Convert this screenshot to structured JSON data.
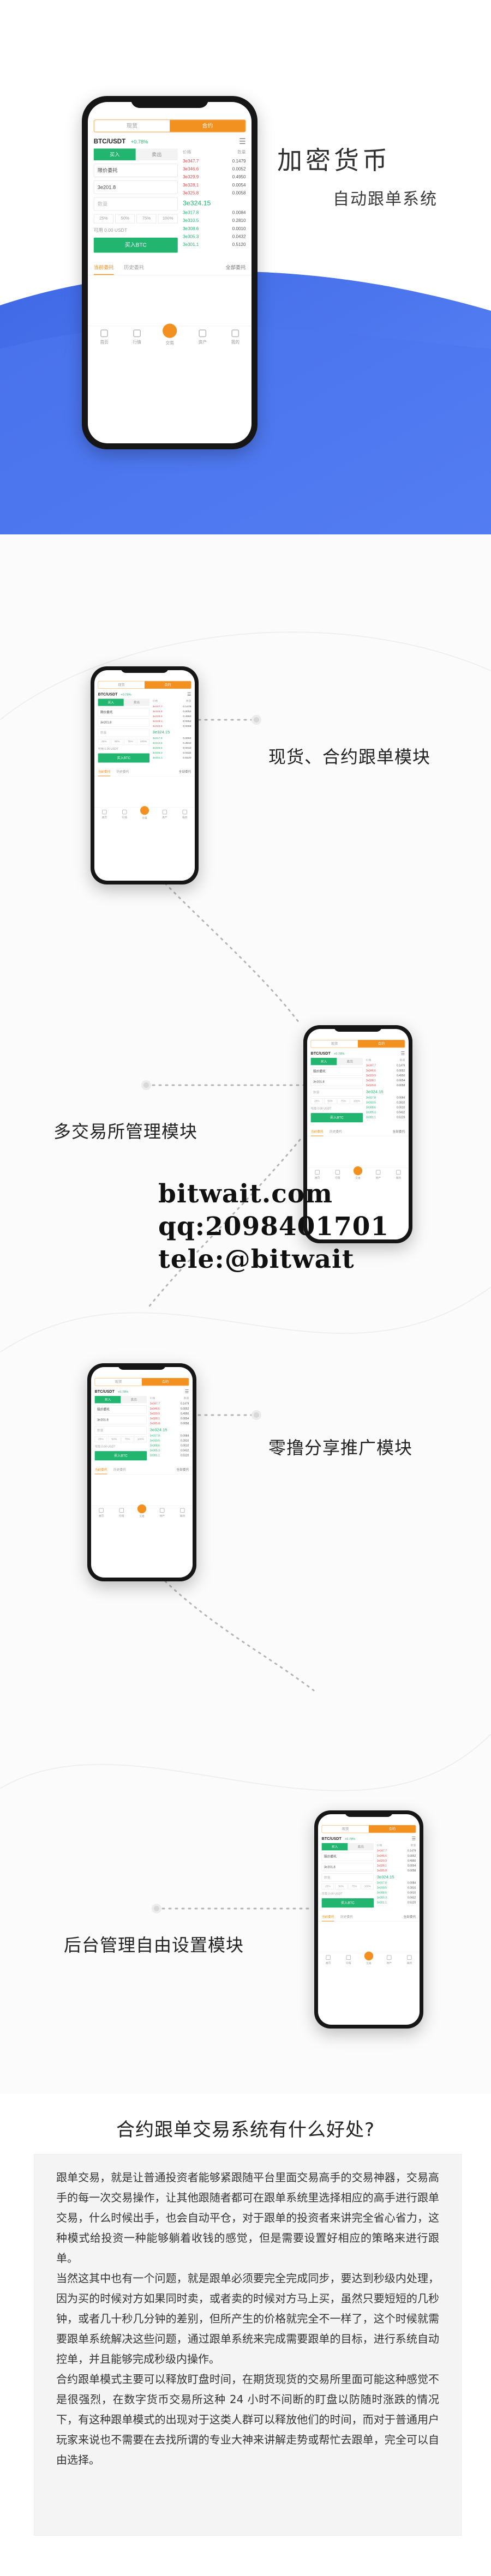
{
  "hero": {
    "title": "加密货币",
    "subtitle": "自动跟单系统"
  },
  "app": {
    "segment": [
      "现货",
      "合约"
    ],
    "pair": "BTC/USDT",
    "change": "+0.78%",
    "menu_icon": "list-icon",
    "buy_tab": "买入",
    "sell_tab": "卖出",
    "order_type": "限价委托",
    "price_value": "3e201.8",
    "amount_placeholder": "数量",
    "percents": [
      "25%",
      "50%",
      "75%",
      "100%"
    ],
    "available": "可用 0.00 USDT",
    "buy_button": "买入BTC",
    "orderbook_headers": [
      "价格",
      "数量"
    ],
    "asks": [
      {
        "p": "3e347.7",
        "q": "0.1479"
      },
      {
        "p": "3e346.6",
        "q": "0.0052"
      },
      {
        "p": "3e329.9",
        "q": "0.4950"
      },
      {
        "p": "3e328.1",
        "q": "0.0054"
      },
      {
        "p": "3e325.8",
        "q": "0.0058"
      }
    ],
    "last_price": "3e324.15",
    "bids": [
      {
        "p": "3e317.8",
        "q": "0.0084"
      },
      {
        "p": "3e310.5",
        "q": "0.2810"
      },
      {
        "p": "3e308.6",
        "q": "0.0010"
      },
      {
        "p": "3e305.3",
        "q": "0.0432"
      },
      {
        "p": "3e301.1",
        "q": "0.5120"
      }
    ],
    "orders_tabs": [
      "当前委托",
      "历史委托"
    ],
    "orders_more": "全部委托",
    "nav": [
      "首页",
      "行情",
      "交易",
      "资产",
      "我的"
    ],
    "accent": "#f29020",
    "buy_color": "#21b56f",
    "sell_color": "#e84a4a"
  },
  "features": [
    {
      "label": "现货、合约跟单模块"
    },
    {
      "label": "多交易所管理模块"
    },
    {
      "label": "零撸分享推广模块"
    },
    {
      "label": "后台管理自由设置模块"
    }
  ],
  "contact": {
    "site": "bitwait.com",
    "qq": "qq:2098401701",
    "tele": "tele:@bitwait"
  },
  "article": {
    "title": "合约跟单交易系统有什么好处?",
    "paragraphs": [
      "跟单交易，就是让普通投资者能够紧跟随平台里面交易高手的交易神器，交易高手的每一次交易操作，让其他跟随者都可在跟单系统里选择相应的高手进行跟单交易，什么时候出手，也会自动平仓，对于跟单的投资者来讲完全省心省力，这种模式给投资一种能够躺着收钱的感觉，但是需要设置好相应的策略来进行跟单。",
      "当然这其中也有一个问题，就是跟单必须要完全完成同步，要达到秒级内处理，因为买的时候对方如果同时卖，或者卖的时候对方马上买，虽然只要短短的几秒钟，或者几十秒几分钟的差别，但所产生的价格就完全不一样了，这个时候就需要跟单系统解决这些问题，通过跟单系统来完成需要跟单的目标，进行系统自动控单，并且能够完成秒级内操作。",
      "合约跟单模式主要可以释放盯盘时间，在期货现货的交易所里面可能这种感觉不是很强烈，在数字货币交易所这种 24 小时不间断的盯盘以防随时涨跌的情况下，有这种跟单模式的出现对于这类人群可以释放他们的时间，而对于普通用户玩家来说也不需要在去找所谓的专业大神来讲解走势或帮忙去跟单，完全可以自由选择。"
    ]
  }
}
